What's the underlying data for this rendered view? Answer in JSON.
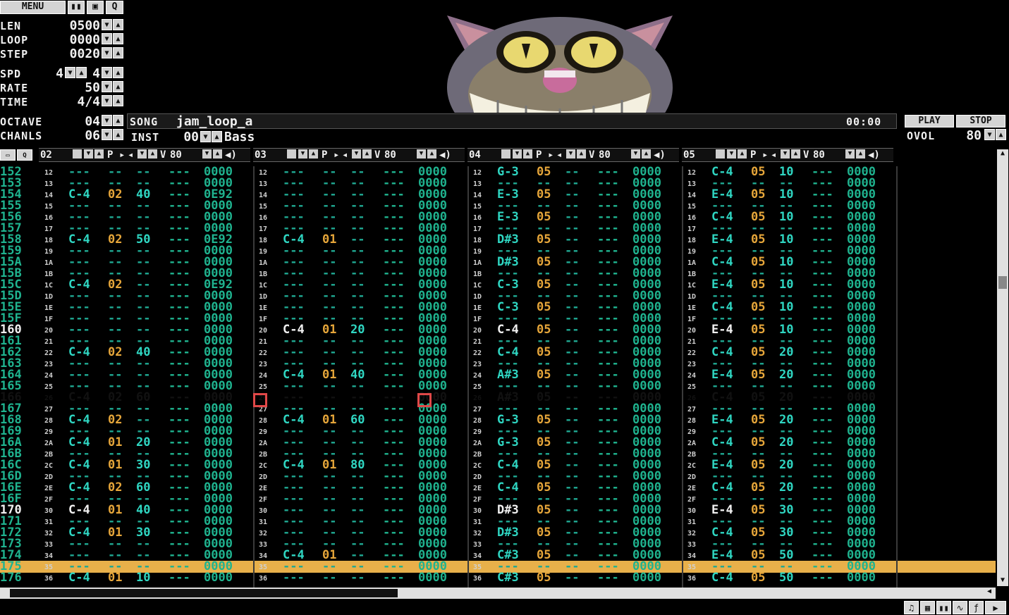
{
  "toolbar": {
    "menu": "MENU"
  },
  "params": {
    "len_label": "LEN",
    "len": "0500",
    "loop_label": "LOOP",
    "loop": "0000",
    "step_label": "STEP",
    "step": "0020",
    "spd_label": "SPD",
    "spd_a": "4",
    "spd_b": "4",
    "rate_label": "RATE",
    "rate": "50",
    "time_label": "TIME",
    "time": "4/4",
    "octave_label": "OCTAVE",
    "octave": "04",
    "chanls_label": "CHANLS",
    "chanls": "06"
  },
  "song": {
    "label": "SONG",
    "name": "jam_loop_a",
    "time": "00:00",
    "inst_label": "INST",
    "inst_num": "00",
    "inst_name": "Bass"
  },
  "transport": {
    "play": "PLAY",
    "stop": "STOP",
    "ovol_label": "OVOL",
    "ovol": "80"
  },
  "channels": [
    {
      "num": "02",
      "vol": "80"
    },
    {
      "num": "03",
      "vol": "80"
    },
    {
      "num": "04",
      "vol": "80"
    },
    {
      "num": "05",
      "vol": "80"
    }
  ],
  "channel_head": {
    "p": "P",
    "v": "V"
  },
  "rows": [
    "152",
    "153",
    "154",
    "155",
    "156",
    "157",
    "158",
    "159",
    "15A",
    "15B",
    "15C",
    "15D",
    "15E",
    "15F",
    "160",
    "161",
    "162",
    "163",
    "164",
    "165",
    "166",
    "167",
    "168",
    "169",
    "16A",
    "16B",
    "16C",
    "16D",
    "16E",
    "16F",
    "170",
    "171",
    "172",
    "173",
    "174",
    "175",
    "176"
  ],
  "subrows": [
    "12",
    "13",
    "14",
    "15",
    "16",
    "17",
    "18",
    "19",
    "1A",
    "1B",
    "1C",
    "1D",
    "1E",
    "1F",
    "20",
    "21",
    "22",
    "23",
    "24",
    "25",
    "26",
    "27",
    "28",
    "29",
    "2A",
    "2B",
    "2C",
    "2D",
    "2E",
    "2F",
    "30",
    "31",
    "32",
    "33",
    "34",
    "35",
    "36"
  ],
  "ch02": [
    [
      "---",
      "--",
      "--",
      "---",
      "0000"
    ],
    [
      "---",
      "--",
      "--",
      "---",
      "0000"
    ],
    [
      "C-4",
      "02",
      "40",
      "---",
      "0E92"
    ],
    [
      "---",
      "--",
      "--",
      "---",
      "0000"
    ],
    [
      "---",
      "--",
      "--",
      "---",
      "0000"
    ],
    [
      "---",
      "--",
      "--",
      "---",
      "0000"
    ],
    [
      "C-4",
      "02",
      "50",
      "---",
      "0E92"
    ],
    [
      "---",
      "--",
      "--",
      "---",
      "0000"
    ],
    [
      "---",
      "--",
      "--",
      "---",
      "0000"
    ],
    [
      "---",
      "--",
      "--",
      "---",
      "0000"
    ],
    [
      "C-4",
      "02",
      "--",
      "---",
      "0E92"
    ],
    [
      "---",
      "--",
      "--",
      "---",
      "0000"
    ],
    [
      "---",
      "--",
      "--",
      "---",
      "0000"
    ],
    [
      "---",
      "--",
      "--",
      "---",
      "0000"
    ],
    [
      "---",
      "--",
      "--",
      "---",
      "0000"
    ],
    [
      "---",
      "--",
      "--",
      "---",
      "0000"
    ],
    [
      "C-4",
      "02",
      "40",
      "---",
      "0000"
    ],
    [
      "---",
      "--",
      "--",
      "---",
      "0000"
    ],
    [
      "---",
      "--",
      "--",
      "---",
      "0000"
    ],
    [
      "---",
      "--",
      "--",
      "---",
      "0000"
    ],
    [
      "C-4",
      "02",
      "60",
      "---",
      "0000"
    ],
    [
      "---",
      "--",
      "--",
      "---",
      "0000"
    ],
    [
      "C-4",
      "02",
      "--",
      "---",
      "0000"
    ],
    [
      "---",
      "--",
      "--",
      "---",
      "0000"
    ],
    [
      "C-4",
      "01",
      "20",
      "---",
      "0000"
    ],
    [
      "---",
      "--",
      "--",
      "---",
      "0000"
    ],
    [
      "C-4",
      "01",
      "30",
      "---",
      "0000"
    ],
    [
      "---",
      "--",
      "--",
      "---",
      "0000"
    ],
    [
      "C-4",
      "02",
      "60",
      "---",
      "0000"
    ],
    [
      "---",
      "--",
      "--",
      "---",
      "0000"
    ],
    [
      "C-4",
      "01",
      "40",
      "---",
      "0000"
    ],
    [
      "---",
      "--",
      "--",
      "---",
      "0000"
    ],
    [
      "C-4",
      "01",
      "30",
      "---",
      "0000"
    ],
    [
      "---",
      "--",
      "--",
      "---",
      "0000"
    ],
    [
      "---",
      "--",
      "--",
      "---",
      "0000"
    ],
    [
      "---",
      "--",
      "--",
      "---",
      "0000"
    ],
    [
      "C-4",
      "01",
      "10",
      "---",
      "0000"
    ]
  ],
  "ch03": [
    [
      "---",
      "--",
      "--",
      "---",
      "0000"
    ],
    [
      "---",
      "--",
      "--",
      "---",
      "0000"
    ],
    [
      "---",
      "--",
      "--",
      "---",
      "0000"
    ],
    [
      "---",
      "--",
      "--",
      "---",
      "0000"
    ],
    [
      "---",
      "--",
      "--",
      "---",
      "0000"
    ],
    [
      "---",
      "--",
      "--",
      "---",
      "0000"
    ],
    [
      "C-4",
      "01",
      "--",
      "---",
      "0000"
    ],
    [
      "---",
      "--",
      "--",
      "---",
      "0000"
    ],
    [
      "---",
      "--",
      "--",
      "---",
      "0000"
    ],
    [
      "---",
      "--",
      "--",
      "---",
      "0000"
    ],
    [
      "---",
      "--",
      "--",
      "---",
      "0000"
    ],
    [
      "---",
      "--",
      "--",
      "---",
      "0000"
    ],
    [
      "---",
      "--",
      "--",
      "---",
      "0000"
    ],
    [
      "---",
      "--",
      "--",
      "---",
      "0000"
    ],
    [
      "C-4",
      "01",
      "20",
      "---",
      "0000"
    ],
    [
      "---",
      "--",
      "--",
      "---",
      "0000"
    ],
    [
      "---",
      "--",
      "--",
      "---",
      "0000"
    ],
    [
      "---",
      "--",
      "--",
      "---",
      "0000"
    ],
    [
      "C-4",
      "01",
      "40",
      "---",
      "0000"
    ],
    [
      "---",
      "--",
      "--",
      "---",
      "0000"
    ],
    [
      "---",
      "--",
      "--",
      "---",
      "0000"
    ],
    [
      "---",
      "--",
      "--",
      "---",
      "0000"
    ],
    [
      "C-4",
      "01",
      "60",
      "---",
      "0000"
    ],
    [
      "---",
      "--",
      "--",
      "---",
      "0000"
    ],
    [
      "---",
      "--",
      "--",
      "---",
      "0000"
    ],
    [
      "---",
      "--",
      "--",
      "---",
      "0000"
    ],
    [
      "C-4",
      "01",
      "80",
      "---",
      "0000"
    ],
    [
      "---",
      "--",
      "--",
      "---",
      "0000"
    ],
    [
      "---",
      "--",
      "--",
      "---",
      "0000"
    ],
    [
      "---",
      "--",
      "--",
      "---",
      "0000"
    ],
    [
      "---",
      "--",
      "--",
      "---",
      "0000"
    ],
    [
      "---",
      "--",
      "--",
      "---",
      "0000"
    ],
    [
      "---",
      "--",
      "--",
      "---",
      "0000"
    ],
    [
      "---",
      "--",
      "--",
      "---",
      "0000"
    ],
    [
      "C-4",
      "01",
      "--",
      "---",
      "0000"
    ],
    [
      "---",
      "--",
      "--",
      "---",
      "0000"
    ],
    [
      "---",
      "--",
      "--",
      "---",
      "0000"
    ]
  ],
  "ch04": [
    [
      "G-3",
      "05",
      "--",
      "---",
      "0000"
    ],
    [
      "---",
      "--",
      "--",
      "---",
      "0000"
    ],
    [
      "E-3",
      "05",
      "--",
      "---",
      "0000"
    ],
    [
      "---",
      "--",
      "--",
      "---",
      "0000"
    ],
    [
      "E-3",
      "05",
      "--",
      "---",
      "0000"
    ],
    [
      "---",
      "--",
      "--",
      "---",
      "0000"
    ],
    [
      "D#3",
      "05",
      "--",
      "---",
      "0000"
    ],
    [
      "---",
      "--",
      "--",
      "---",
      "0000"
    ],
    [
      "D#3",
      "05",
      "--",
      "---",
      "0000"
    ],
    [
      "---",
      "--",
      "--",
      "---",
      "0000"
    ],
    [
      "C-3",
      "05",
      "--",
      "---",
      "0000"
    ],
    [
      "---",
      "--",
      "--",
      "---",
      "0000"
    ],
    [
      "C-3",
      "05",
      "--",
      "---",
      "0000"
    ],
    [
      "---",
      "--",
      "--",
      "---",
      "0000"
    ],
    [
      "C-4",
      "05",
      "--",
      "---",
      "0000"
    ],
    [
      "---",
      "--",
      "--",
      "---",
      "0000"
    ],
    [
      "C-4",
      "05",
      "--",
      "---",
      "0000"
    ],
    [
      "---",
      "--",
      "--",
      "---",
      "0000"
    ],
    [
      "A#3",
      "05",
      "--",
      "---",
      "0000"
    ],
    [
      "---",
      "--",
      "--",
      "---",
      "0000"
    ],
    [
      "A#3",
      "05",
      "--",
      "---",
      "0000"
    ],
    [
      "---",
      "--",
      "--",
      "---",
      "0000"
    ],
    [
      "G-3",
      "05",
      "--",
      "---",
      "0000"
    ],
    [
      "---",
      "--",
      "--",
      "---",
      "0000"
    ],
    [
      "G-3",
      "05",
      "--",
      "---",
      "0000"
    ],
    [
      "---",
      "--",
      "--",
      "---",
      "0000"
    ],
    [
      "C-4",
      "05",
      "--",
      "---",
      "0000"
    ],
    [
      "---",
      "--",
      "--",
      "---",
      "0000"
    ],
    [
      "C-4",
      "05",
      "--",
      "---",
      "0000"
    ],
    [
      "---",
      "--",
      "--",
      "---",
      "0000"
    ],
    [
      "D#3",
      "05",
      "--",
      "---",
      "0000"
    ],
    [
      "---",
      "--",
      "--",
      "---",
      "0000"
    ],
    [
      "D#3",
      "05",
      "--",
      "---",
      "0000"
    ],
    [
      "---",
      "--",
      "--",
      "---",
      "0000"
    ],
    [
      "C#3",
      "05",
      "--",
      "---",
      "0000"
    ],
    [
      "---",
      "--",
      "--",
      "---",
      "0000"
    ],
    [
      "C#3",
      "05",
      "--",
      "---",
      "0000"
    ]
  ],
  "ch05": [
    [
      "C-4",
      "05",
      "10",
      "---",
      "0000"
    ],
    [
      "---",
      "--",
      "--",
      "---",
      "0000"
    ],
    [
      "E-4",
      "05",
      "10",
      "---",
      "0000"
    ],
    [
      "---",
      "--",
      "--",
      "---",
      "0000"
    ],
    [
      "C-4",
      "05",
      "10",
      "---",
      "0000"
    ],
    [
      "---",
      "--",
      "--",
      "---",
      "0000"
    ],
    [
      "E-4",
      "05",
      "10",
      "---",
      "0000"
    ],
    [
      "---",
      "--",
      "--",
      "---",
      "0000"
    ],
    [
      "C-4",
      "05",
      "10",
      "---",
      "0000"
    ],
    [
      "---",
      "--",
      "--",
      "---",
      "0000"
    ],
    [
      "E-4",
      "05",
      "10",
      "---",
      "0000"
    ],
    [
      "---",
      "--",
      "--",
      "---",
      "0000"
    ],
    [
      "C-4",
      "05",
      "10",
      "---",
      "0000"
    ],
    [
      "---",
      "--",
      "--",
      "---",
      "0000"
    ],
    [
      "E-4",
      "05",
      "10",
      "---",
      "0000"
    ],
    [
      "---",
      "--",
      "--",
      "---",
      "0000"
    ],
    [
      "C-4",
      "05",
      "20",
      "---",
      "0000"
    ],
    [
      "---",
      "--",
      "--",
      "---",
      "0000"
    ],
    [
      "E-4",
      "05",
      "20",
      "---",
      "0000"
    ],
    [
      "---",
      "--",
      "--",
      "---",
      "0000"
    ],
    [
      "C-4",
      "05",
      "20",
      "---",
      "0000"
    ],
    [
      "---",
      "--",
      "--",
      "---",
      "0000"
    ],
    [
      "E-4",
      "05",
      "20",
      "---",
      "0000"
    ],
    [
      "---",
      "--",
      "--",
      "---",
      "0000"
    ],
    [
      "C-4",
      "05",
      "20",
      "---",
      "0000"
    ],
    [
      "---",
      "--",
      "--",
      "---",
      "0000"
    ],
    [
      "E-4",
      "05",
      "20",
      "---",
      "0000"
    ],
    [
      "---",
      "--",
      "--",
      "---",
      "0000"
    ],
    [
      "C-4",
      "05",
      "20",
      "---",
      "0000"
    ],
    [
      "---",
      "--",
      "--",
      "---",
      "0000"
    ],
    [
      "E-4",
      "05",
      "30",
      "---",
      "0000"
    ],
    [
      "---",
      "--",
      "--",
      "---",
      "0000"
    ],
    [
      "C-4",
      "05",
      "30",
      "---",
      "0000"
    ],
    [
      "---",
      "--",
      "--",
      "---",
      "0000"
    ],
    [
      "E-4",
      "05",
      "50",
      "---",
      "0000"
    ],
    [
      "---",
      "--",
      "--",
      "---",
      "0000"
    ],
    [
      "C-4",
      "05",
      "50",
      "---",
      "0000"
    ]
  ],
  "colors": {
    "note": "#2fd6c2",
    "note_dim": "#1fa892",
    "inst": "#e6a63a",
    "vol": "#2fd6c2",
    "eff": "#1fb38f",
    "highlight": "#e8b04a",
    "white": "#f0f0f0"
  }
}
